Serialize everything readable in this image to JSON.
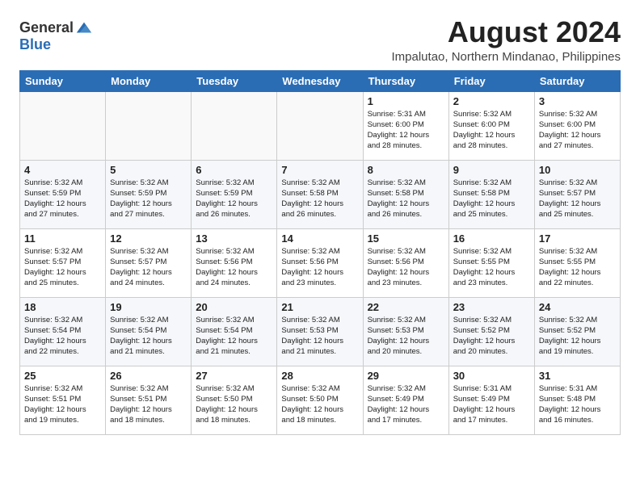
{
  "logo": {
    "text1": "General",
    "text2": "Blue"
  },
  "header": {
    "month_year": "August 2024",
    "location": "Impalutao, Northern Mindanao, Philippines"
  },
  "weekdays": [
    "Sunday",
    "Monday",
    "Tuesday",
    "Wednesday",
    "Thursday",
    "Friday",
    "Saturday"
  ],
  "weeks": [
    [
      {
        "day": "",
        "info": ""
      },
      {
        "day": "",
        "info": ""
      },
      {
        "day": "",
        "info": ""
      },
      {
        "day": "",
        "info": ""
      },
      {
        "day": "1",
        "info": "Sunrise: 5:31 AM\nSunset: 6:00 PM\nDaylight: 12 hours\nand 28 minutes."
      },
      {
        "day": "2",
        "info": "Sunrise: 5:32 AM\nSunset: 6:00 PM\nDaylight: 12 hours\nand 28 minutes."
      },
      {
        "day": "3",
        "info": "Sunrise: 5:32 AM\nSunset: 6:00 PM\nDaylight: 12 hours\nand 27 minutes."
      }
    ],
    [
      {
        "day": "4",
        "info": "Sunrise: 5:32 AM\nSunset: 5:59 PM\nDaylight: 12 hours\nand 27 minutes."
      },
      {
        "day": "5",
        "info": "Sunrise: 5:32 AM\nSunset: 5:59 PM\nDaylight: 12 hours\nand 27 minutes."
      },
      {
        "day": "6",
        "info": "Sunrise: 5:32 AM\nSunset: 5:59 PM\nDaylight: 12 hours\nand 26 minutes."
      },
      {
        "day": "7",
        "info": "Sunrise: 5:32 AM\nSunset: 5:58 PM\nDaylight: 12 hours\nand 26 minutes."
      },
      {
        "day": "8",
        "info": "Sunrise: 5:32 AM\nSunset: 5:58 PM\nDaylight: 12 hours\nand 26 minutes."
      },
      {
        "day": "9",
        "info": "Sunrise: 5:32 AM\nSunset: 5:58 PM\nDaylight: 12 hours\nand 25 minutes."
      },
      {
        "day": "10",
        "info": "Sunrise: 5:32 AM\nSunset: 5:57 PM\nDaylight: 12 hours\nand 25 minutes."
      }
    ],
    [
      {
        "day": "11",
        "info": "Sunrise: 5:32 AM\nSunset: 5:57 PM\nDaylight: 12 hours\nand 25 minutes."
      },
      {
        "day": "12",
        "info": "Sunrise: 5:32 AM\nSunset: 5:57 PM\nDaylight: 12 hours\nand 24 minutes."
      },
      {
        "day": "13",
        "info": "Sunrise: 5:32 AM\nSunset: 5:56 PM\nDaylight: 12 hours\nand 24 minutes."
      },
      {
        "day": "14",
        "info": "Sunrise: 5:32 AM\nSunset: 5:56 PM\nDaylight: 12 hours\nand 23 minutes."
      },
      {
        "day": "15",
        "info": "Sunrise: 5:32 AM\nSunset: 5:56 PM\nDaylight: 12 hours\nand 23 minutes."
      },
      {
        "day": "16",
        "info": "Sunrise: 5:32 AM\nSunset: 5:55 PM\nDaylight: 12 hours\nand 23 minutes."
      },
      {
        "day": "17",
        "info": "Sunrise: 5:32 AM\nSunset: 5:55 PM\nDaylight: 12 hours\nand 22 minutes."
      }
    ],
    [
      {
        "day": "18",
        "info": "Sunrise: 5:32 AM\nSunset: 5:54 PM\nDaylight: 12 hours\nand 22 minutes."
      },
      {
        "day": "19",
        "info": "Sunrise: 5:32 AM\nSunset: 5:54 PM\nDaylight: 12 hours\nand 21 minutes."
      },
      {
        "day": "20",
        "info": "Sunrise: 5:32 AM\nSunset: 5:54 PM\nDaylight: 12 hours\nand 21 minutes."
      },
      {
        "day": "21",
        "info": "Sunrise: 5:32 AM\nSunset: 5:53 PM\nDaylight: 12 hours\nand 21 minutes."
      },
      {
        "day": "22",
        "info": "Sunrise: 5:32 AM\nSunset: 5:53 PM\nDaylight: 12 hours\nand 20 minutes."
      },
      {
        "day": "23",
        "info": "Sunrise: 5:32 AM\nSunset: 5:52 PM\nDaylight: 12 hours\nand 20 minutes."
      },
      {
        "day": "24",
        "info": "Sunrise: 5:32 AM\nSunset: 5:52 PM\nDaylight: 12 hours\nand 19 minutes."
      }
    ],
    [
      {
        "day": "25",
        "info": "Sunrise: 5:32 AM\nSunset: 5:51 PM\nDaylight: 12 hours\nand 19 minutes."
      },
      {
        "day": "26",
        "info": "Sunrise: 5:32 AM\nSunset: 5:51 PM\nDaylight: 12 hours\nand 18 minutes."
      },
      {
        "day": "27",
        "info": "Sunrise: 5:32 AM\nSunset: 5:50 PM\nDaylight: 12 hours\nand 18 minutes."
      },
      {
        "day": "28",
        "info": "Sunrise: 5:32 AM\nSunset: 5:50 PM\nDaylight: 12 hours\nand 18 minutes."
      },
      {
        "day": "29",
        "info": "Sunrise: 5:32 AM\nSunset: 5:49 PM\nDaylight: 12 hours\nand 17 minutes."
      },
      {
        "day": "30",
        "info": "Sunrise: 5:31 AM\nSunset: 5:49 PM\nDaylight: 12 hours\nand 17 minutes."
      },
      {
        "day": "31",
        "info": "Sunrise: 5:31 AM\nSunset: 5:48 PM\nDaylight: 12 hours\nand 16 minutes."
      }
    ]
  ]
}
